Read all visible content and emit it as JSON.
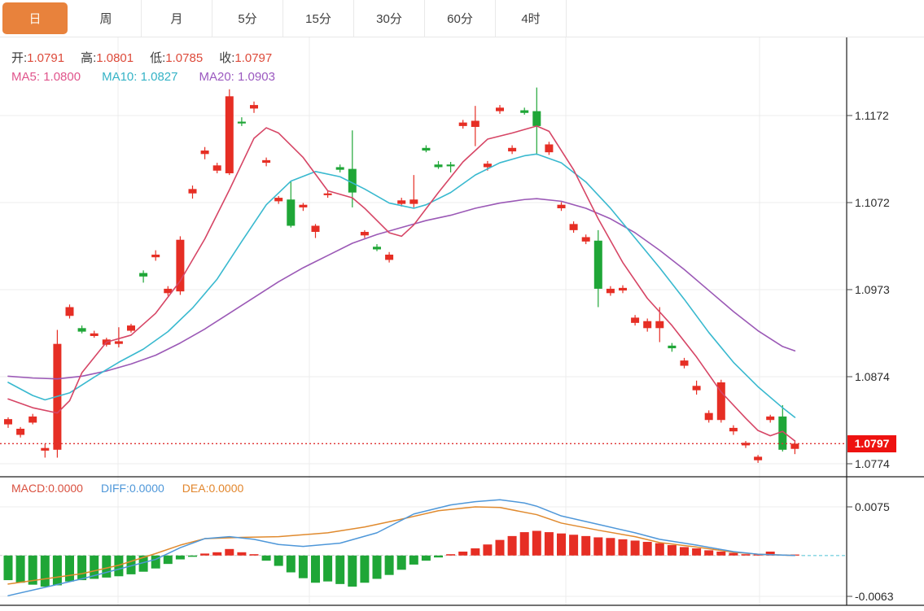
{
  "tabs": [
    {
      "label": "日",
      "active": true
    },
    {
      "label": "周",
      "active": false
    },
    {
      "label": "月",
      "active": false
    },
    {
      "label": "5分",
      "active": false
    },
    {
      "label": "15分",
      "active": false
    },
    {
      "label": "30分",
      "active": false
    },
    {
      "label": "60分",
      "active": false
    },
    {
      "label": "4时",
      "active": false
    }
  ],
  "quote_bar": {
    "open_label": "开:",
    "open_value": "1.0791",
    "high_label": "高:",
    "high_value": "1.0801",
    "low_label": "低:",
    "low_value": "1.0785",
    "close_label": "收:",
    "close_value": "1.0797"
  },
  "ma_bar": {
    "ma5_label": "MA5:",
    "ma5_value": "1.0800",
    "ma10_label": "MA10:",
    "ma10_value": "1.0827",
    "ma20_label": "MA20:",
    "ma20_value": "1.0903"
  },
  "macd_bar": {
    "macd_label": "MACD:",
    "macd_value": "0.0000",
    "diff_label": "DIFF:",
    "diff_value": "0.0000",
    "dea_label": "DEA:",
    "dea_value": "0.0000"
  },
  "price_tag": {
    "value": "1.0797"
  },
  "colors": {
    "up": "#e62e24",
    "down": "#1fa637",
    "ma5": "#d64565",
    "ma10": "#39b9cf",
    "ma20": "#9b59b6",
    "diff_line": "#4e97d9",
    "dea_line": "#e08a2e",
    "accent_tab": "#e8823c",
    "quote_value": "#dd4a3a",
    "dotted_line": "#e03131",
    "tag_bg": "#ee1210",
    "grid": "#ececec",
    "border": "#1f1f1f",
    "axis_text": "#2b2b2b",
    "zero_dash_gray": "#cccccc",
    "zero_dash_cyan": "#7ed3e0"
  },
  "chart_data": {
    "type": "candlestick_with_macd",
    "legend_note": "red candle = close>=open (up), green candle = close<open (down)",
    "main": {
      "y_ticks": [
        1.1172,
        1.1072,
        1.0973,
        1.0874,
        1.0774
      ],
      "last_close": 1.0797,
      "candles": [
        [
          1.0819,
          1.0827,
          1.0815,
          1.0825
        ],
        [
          1.0807,
          1.0816,
          1.0804,
          1.0814
        ],
        [
          1.0821,
          1.0831,
          1.0819,
          1.0828
        ],
        [
          1.0789,
          1.0797,
          1.0781,
          1.0792
        ],
        [
          1.079,
          1.0927,
          1.0781,
          1.0911
        ],
        [
          1.0943,
          1.0956,
          1.094,
          1.0953
        ],
        [
          1.0929,
          1.0932,
          1.0923,
          1.0925
        ],
        [
          1.092,
          1.0926,
          1.0918,
          1.0923
        ],
        [
          1.091,
          1.0918,
          1.0908,
          1.0916
        ],
        [
          1.0911,
          1.093,
          1.0907,
          1.0914
        ],
        [
          1.0926,
          1.0934,
          1.0924,
          1.0932
        ],
        [
          1.0992,
          1.0995,
          1.0981,
          1.0988
        ],
        [
          1.101,
          1.1018,
          1.1006,
          1.1013
        ],
        [
          1.0969,
          1.0977,
          1.0966,
          1.0974
        ],
        [
          1.0971,
          1.1034,
          1.0967,
          1.103
        ],
        [
          1.1083,
          1.1092,
          1.1077,
          1.1088
        ],
        [
          1.1128,
          1.1136,
          1.1122,
          1.1132
        ],
        [
          1.1109,
          1.1118,
          1.1106,
          1.1115
        ],
        [
          1.1106,
          1.1202,
          1.1104,
          1.1194
        ],
        [
          1.1165,
          1.117,
          1.116,
          1.1163
        ],
        [
          1.118,
          1.1188,
          1.1175,
          1.1184
        ],
        [
          1.1118,
          1.1124,
          1.1114,
          1.1121
        ],
        [
          1.1074,
          1.108,
          1.1071,
          1.1078
        ],
        [
          1.1076,
          1.1097,
          1.1044,
          1.1046
        ],
        [
          1.1067,
          1.1072,
          1.1063,
          1.107
        ],
        [
          1.1039,
          1.1048,
          1.1032,
          1.1046
        ],
        [
          1.1081,
          1.1086,
          1.1078,
          1.1083
        ],
        [
          1.1113,
          1.1116,
          1.1107,
          1.111
        ],
        [
          1.1111,
          1.1155,
          1.1067,
          1.1084
        ],
        [
          1.1035,
          1.1041,
          1.1032,
          1.1039
        ],
        [
          1.1022,
          1.1025,
          1.1017,
          1.1019
        ],
        [
          1.1007,
          1.1016,
          1.1004,
          1.1013
        ],
        [
          1.1071,
          1.1078,
          1.1068,
          1.1075
        ],
        [
          1.1071,
          1.1104,
          1.1067,
          1.1076
        ],
        [
          1.1135,
          1.1138,
          1.113,
          1.1132
        ],
        [
          1.1116,
          1.112,
          1.1111,
          1.1113
        ],
        [
          1.1116,
          1.1119,
          1.1107,
          1.1115
        ],
        [
          1.116,
          1.1167,
          1.1157,
          1.1164
        ],
        [
          1.1159,
          1.1183,
          1.1137,
          1.1166
        ],
        [
          1.1113,
          1.112,
          1.1109,
          1.1117
        ],
        [
          1.1177,
          1.1184,
          1.1174,
          1.1181
        ],
        [
          1.1131,
          1.1138,
          1.1128,
          1.1135
        ],
        [
          1.1178,
          1.1181,
          1.1173,
          1.1175
        ],
        [
          1.1177,
          1.1204,
          1.1127,
          1.116
        ],
        [
          1.113,
          1.1142,
          1.1127,
          1.1139
        ],
        [
          1.1066,
          1.1073,
          1.1063,
          1.107
        ],
        [
          1.1041,
          1.1051,
          1.1038,
          1.1048
        ],
        [
          1.1028,
          1.1036,
          1.1025,
          1.1033
        ],
        [
          1.1029,
          1.1041,
          1.0953,
          1.0974
        ],
        [
          1.0969,
          1.0977,
          1.0966,
          1.0974
        ],
        [
          1.0972,
          1.0978,
          1.0969,
          1.0975
        ],
        [
          1.0935,
          1.0944,
          1.0932,
          1.0941
        ],
        [
          1.0929,
          1.094,
          1.0925,
          1.0937
        ],
        [
          1.0929,
          1.0953,
          1.0913,
          1.0937
        ],
        [
          1.0909,
          1.0912,
          1.0902,
          1.0906
        ],
        [
          1.0886,
          1.0895,
          1.0883,
          1.0892
        ],
        [
          1.0858,
          1.0869,
          1.0853,
          1.0863
        ],
        [
          1.0824,
          1.0835,
          1.0821,
          1.0832
        ],
        [
          1.0824,
          1.087,
          1.0821,
          1.0867
        ],
        [
          1.0811,
          1.0818,
          1.0807,
          1.0815
        ],
        [
          1.0795,
          1.08,
          1.0792,
          1.0798
        ],
        [
          1.0778,
          1.0784,
          1.0775,
          1.0782
        ],
        [
          1.0824,
          1.083,
          1.0821,
          1.0828
        ],
        [
          1.0828,
          1.0841,
          1.0788,
          1.079
        ],
        [
          1.0791,
          1.0801,
          1.0785,
          1.0797
        ]
      ],
      "ma5_points": [
        [
          0,
          1.0848
        ],
        [
          2,
          1.0838
        ],
        [
          4,
          1.0832
        ],
        [
          5,
          1.0846
        ],
        [
          6,
          1.0878
        ],
        [
          8,
          1.0913
        ],
        [
          10,
          1.0921
        ],
        [
          12,
          1.0946
        ],
        [
          14,
          1.0983
        ],
        [
          16,
          1.1031
        ],
        [
          18,
          1.1087
        ],
        [
          20,
          1.1146
        ],
        [
          21,
          1.1158
        ],
        [
          22,
          1.1152
        ],
        [
          24,
          1.1124
        ],
        [
          26,
          1.1086
        ],
        [
          28,
          1.1078
        ],
        [
          29,
          1.1066
        ],
        [
          31,
          1.1038
        ],
        [
          32,
          1.1034
        ],
        [
          33,
          1.1047
        ],
        [
          35,
          1.1084
        ],
        [
          37,
          1.1119
        ],
        [
          39,
          1.1145
        ],
        [
          41,
          1.1152
        ],
        [
          43,
          1.116
        ],
        [
          44,
          1.1154
        ],
        [
          46,
          1.111
        ],
        [
          48,
          1.1054
        ],
        [
          50,
          1.1004
        ],
        [
          52,
          1.0963
        ],
        [
          54,
          1.0932
        ],
        [
          56,
          1.0896
        ],
        [
          58,
          1.0856
        ],
        [
          60,
          1.0826
        ],
        [
          61,
          1.0812
        ],
        [
          62,
          1.0806
        ],
        [
          63,
          1.0811
        ],
        [
          64,
          1.08
        ]
      ],
      "ma10_points": [
        [
          0,
          1.0867
        ],
        [
          2,
          1.0852
        ],
        [
          3,
          1.0847
        ],
        [
          5,
          1.0855
        ],
        [
          7,
          1.0873
        ],
        [
          9,
          1.089
        ],
        [
          11,
          1.0905
        ],
        [
          13,
          1.0925
        ],
        [
          15,
          1.0952
        ],
        [
          17,
          1.0985
        ],
        [
          19,
          1.1028
        ],
        [
          21,
          1.107
        ],
        [
          23,
          1.1097
        ],
        [
          25,
          1.1108
        ],
        [
          27,
          1.1102
        ],
        [
          29,
          1.1088
        ],
        [
          31,
          1.1072
        ],
        [
          33,
          1.1066
        ],
        [
          34,
          1.107
        ],
        [
          36,
          1.1084
        ],
        [
          38,
          1.1104
        ],
        [
          40,
          1.1118
        ],
        [
          42,
          1.1126
        ],
        [
          43,
          1.1128
        ],
        [
          45,
          1.1118
        ],
        [
          47,
          1.1096
        ],
        [
          49,
          1.1066
        ],
        [
          51,
          1.1032
        ],
        [
          53,
          1.0998
        ],
        [
          55,
          1.0962
        ],
        [
          57,
          1.0924
        ],
        [
          59,
          1.089
        ],
        [
          61,
          1.0862
        ],
        [
          63,
          1.0838
        ],
        [
          64,
          1.0827
        ]
      ],
      "ma20_points": [
        [
          0,
          1.0874
        ],
        [
          2,
          1.0872
        ],
        [
          4,
          1.0871
        ],
        [
          6,
          1.0874
        ],
        [
          8,
          1.088
        ],
        [
          10,
          1.0888
        ],
        [
          12,
          1.0898
        ],
        [
          14,
          1.0912
        ],
        [
          16,
          1.0928
        ],
        [
          18,
          1.0946
        ],
        [
          20,
          1.0964
        ],
        [
          22,
          1.0982
        ],
        [
          24,
          1.0998
        ],
        [
          26,
          1.1012
        ],
        [
          28,
          1.1026
        ],
        [
          30,
          1.1036
        ],
        [
          32,
          1.1044
        ],
        [
          34,
          1.1052
        ],
        [
          36,
          1.1058
        ],
        [
          38,
          1.1066
        ],
        [
          40,
          1.1072
        ],
        [
          42,
          1.1076
        ],
        [
          43,
          1.1077
        ],
        [
          45,
          1.1074
        ],
        [
          47,
          1.1066
        ],
        [
          49,
          1.1054
        ],
        [
          51,
          1.1038
        ],
        [
          53,
          1.1018
        ],
        [
          55,
          1.0996
        ],
        [
          57,
          1.0972
        ],
        [
          59,
          1.0948
        ],
        [
          61,
          1.0926
        ],
        [
          63,
          1.0908
        ],
        [
          64,
          1.0903
        ]
      ]
    },
    "macd": {
      "y_ticks": [
        0.0075,
        -0.0063
      ],
      "macd_value": 0.0,
      "diff_value": 0.0,
      "dea_value": 0.0,
      "histogram_unit": 0.0001,
      "histogram": [
        -38,
        -42,
        -45,
        -48,
        -46,
        -40,
        -38,
        -36,
        -34,
        -32,
        -29,
        -25,
        -20,
        -13,
        -6,
        -2,
        3,
        5,
        10,
        5,
        2,
        -8,
        -16,
        -26,
        -35,
        -42,
        -40,
        -44,
        -48,
        -42,
        -36,
        -30,
        -22,
        -14,
        -8,
        -3,
        2,
        6,
        11,
        17,
        24,
        30,
        36,
        38,
        36,
        34,
        32,
        30,
        28,
        27,
        25,
        23,
        21,
        19,
        16,
        13,
        11,
        8,
        6,
        4,
        2,
        1,
        6,
        1,
        1
      ],
      "diff_points": [
        [
          0,
          -0.0062
        ],
        [
          3,
          -0.0049
        ],
        [
          6,
          -0.0036
        ],
        [
          9,
          -0.0021
        ],
        [
          12,
          -0.0006
        ],
        [
          14,
          0.0012
        ],
        [
          16,
          0.0026
        ],
        [
          18,
          0.0029
        ],
        [
          20,
          0.0025
        ],
        [
          22,
          0.0017
        ],
        [
          24,
          0.0014
        ],
        [
          27,
          0.0019
        ],
        [
          30,
          0.0035
        ],
        [
          33,
          0.0064
        ],
        [
          36,
          0.0078
        ],
        [
          38,
          0.0083
        ],
        [
          40,
          0.0086
        ],
        [
          42,
          0.0081
        ],
        [
          43,
          0.0076
        ],
        [
          45,
          0.0061
        ],
        [
          48,
          0.0048
        ],
        [
          51,
          0.0035
        ],
        [
          53,
          0.0025
        ],
        [
          56,
          0.0016
        ],
        [
          59,
          0.0006
        ],
        [
          61,
          0.0002
        ],
        [
          64,
          0.0
        ]
      ],
      "dea_points": [
        [
          0,
          -0.0044
        ],
        [
          3,
          -0.0036
        ],
        [
          6,
          -0.0028
        ],
        [
          9,
          -0.0015
        ],
        [
          12,
          0.0003
        ],
        [
          14,
          0.0016
        ],
        [
          16,
          0.0026
        ],
        [
          19,
          0.0028
        ],
        [
          22,
          0.0029
        ],
        [
          26,
          0.0035
        ],
        [
          29,
          0.0044
        ],
        [
          32,
          0.0056
        ],
        [
          35,
          0.0069
        ],
        [
          38,
          0.0075
        ],
        [
          40,
          0.0074
        ],
        [
          43,
          0.0063
        ],
        [
          45,
          0.005
        ],
        [
          48,
          0.0039
        ],
        [
          51,
          0.0029
        ],
        [
          53,
          0.002
        ],
        [
          56,
          0.0013
        ],
        [
          59,
          0.0005
        ],
        [
          61,
          0.0002
        ],
        [
          64,
          0.0
        ]
      ]
    }
  }
}
